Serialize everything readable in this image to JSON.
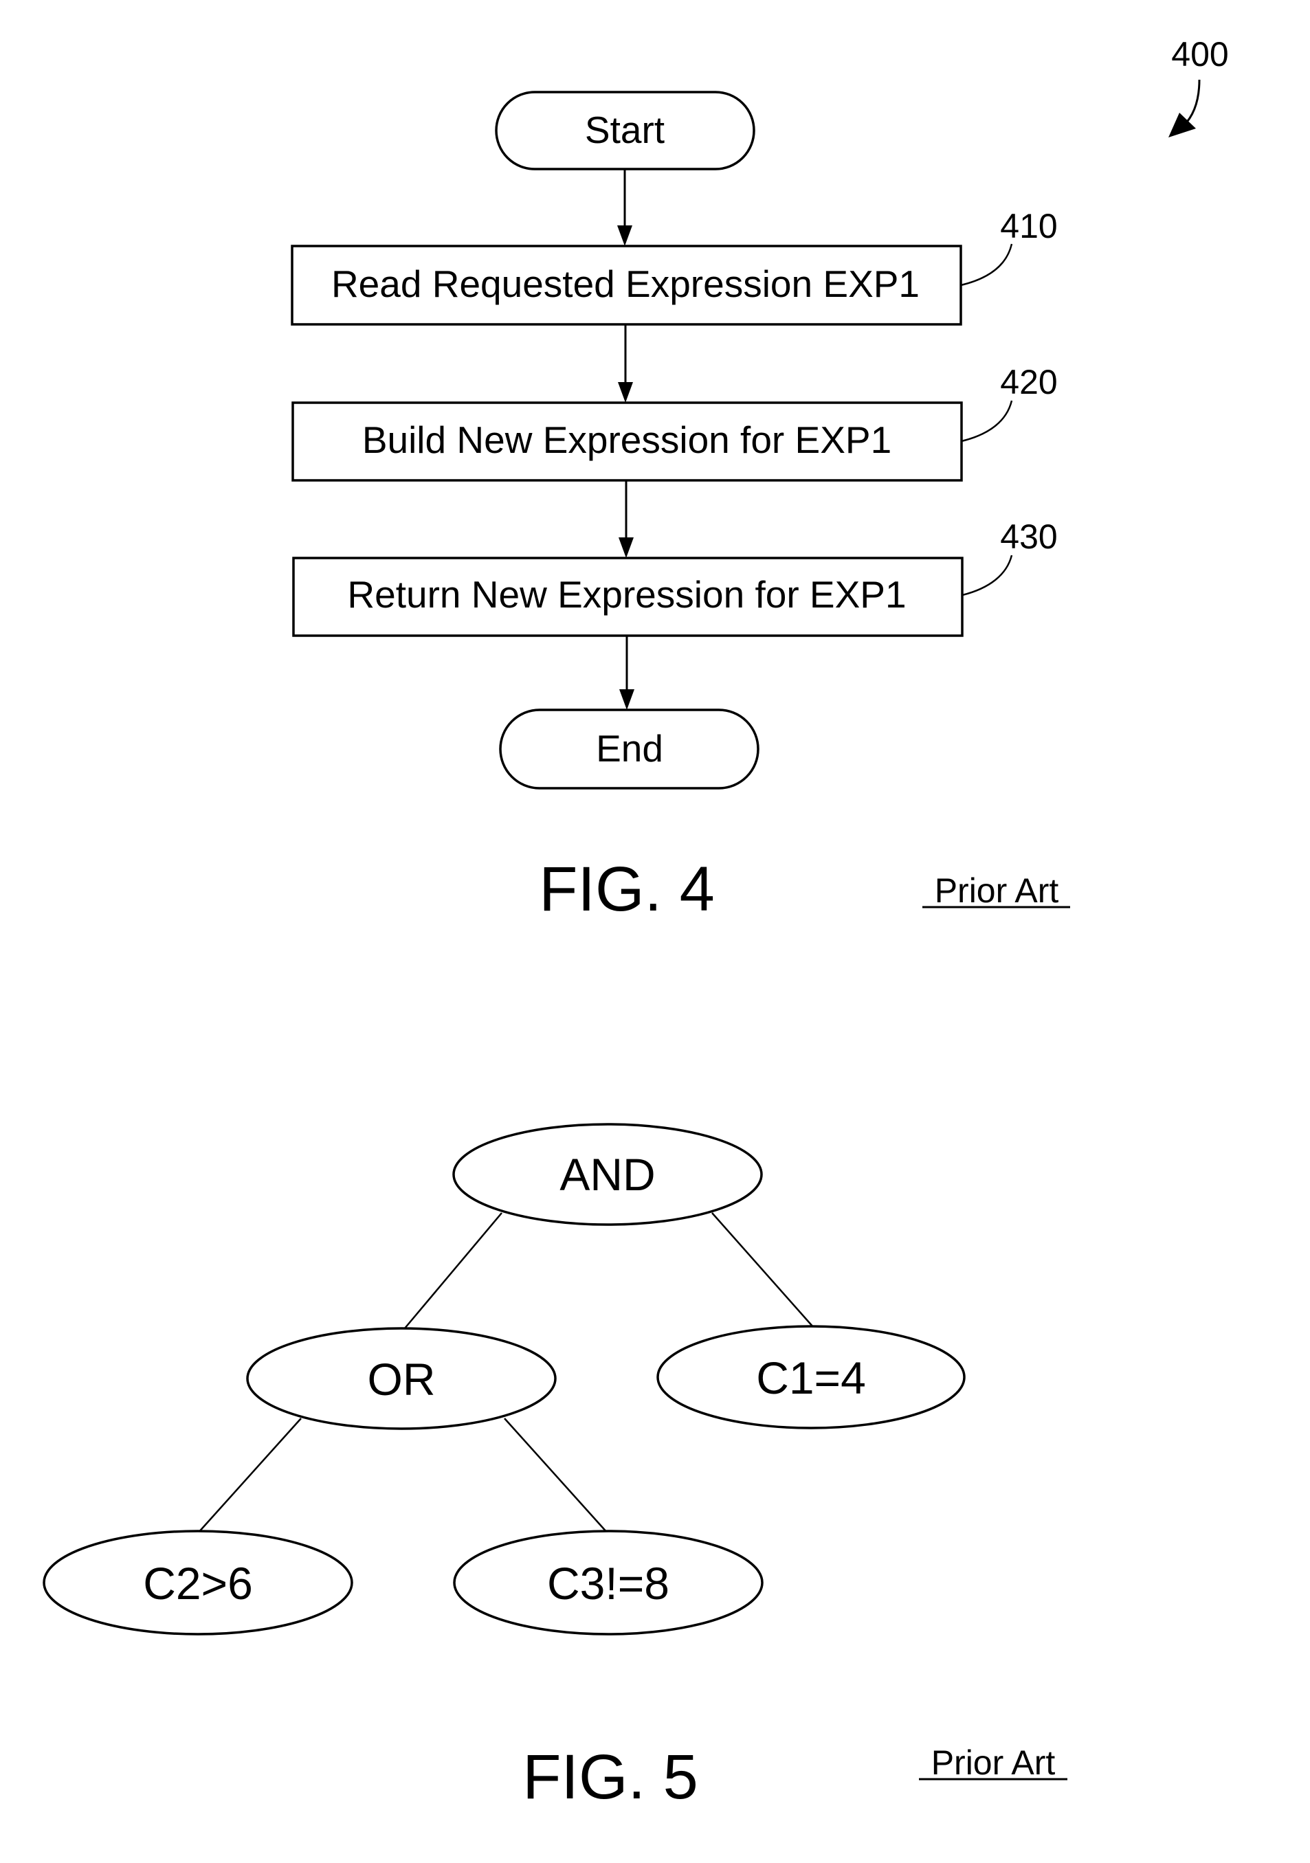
{
  "figure4": {
    "reference": "400",
    "nodes": [
      {
        "id": "start",
        "type": "terminal",
        "label": "Start"
      },
      {
        "id": "step410",
        "type": "process",
        "label": "Read Requested Expression EXP1",
        "ref": "410"
      },
      {
        "id": "step420",
        "type": "process",
        "label": "Build New Expression for EXP1",
        "ref": "420"
      },
      {
        "id": "step430",
        "type": "process",
        "label": "Return New Expression for EXP1",
        "ref": "430"
      },
      {
        "id": "end",
        "type": "terminal",
        "label": "End"
      }
    ],
    "edges": [
      [
        "start",
        "step410"
      ],
      [
        "step410",
        "step420"
      ],
      [
        "step420",
        "step430"
      ],
      [
        "step430",
        "end"
      ]
    ],
    "caption": "FIG. 4",
    "note": "Prior Art"
  },
  "figure5": {
    "nodes": [
      {
        "id": "and",
        "label": "AND"
      },
      {
        "id": "or",
        "label": "OR"
      },
      {
        "id": "c1",
        "label": "C1=4"
      },
      {
        "id": "c2",
        "label": "C2>6"
      },
      {
        "id": "c3",
        "label": "C3!=8"
      }
    ],
    "edges": [
      [
        "and",
        "or"
      ],
      [
        "and",
        "c1"
      ],
      [
        "or",
        "c2"
      ],
      [
        "or",
        "c3"
      ]
    ],
    "caption": "FIG. 5",
    "note": "Prior Art"
  }
}
